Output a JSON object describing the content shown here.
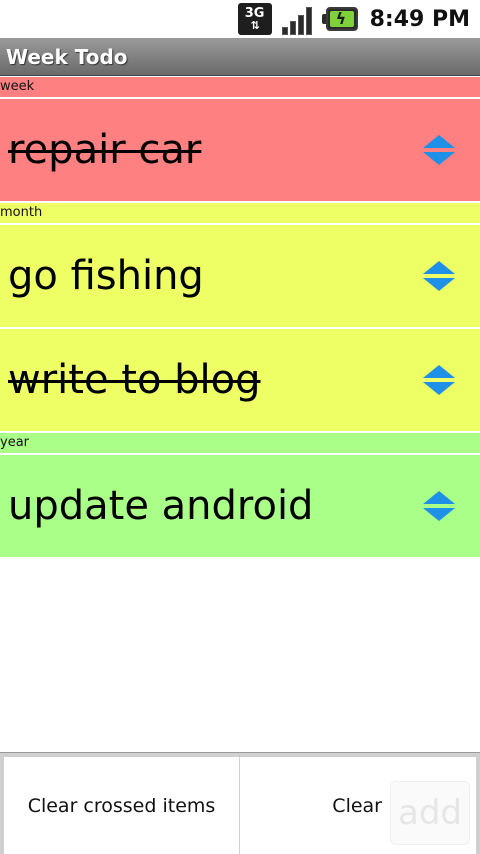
{
  "status_bar": {
    "network_label": "3G",
    "time": "8:49 PM",
    "icons": [
      "3g-data-icon",
      "signal-icon",
      "battery-charging-icon"
    ]
  },
  "app": {
    "title": "Week Todo"
  },
  "sections": [
    {
      "label": "week",
      "color": "#ff8080",
      "items": [
        {
          "text": "repair car",
          "crossed": true
        }
      ]
    },
    {
      "label": "month",
      "color": "#eeff66",
      "items": [
        {
          "text": "go fishing",
          "crossed": false
        },
        {
          "text": "write to blog",
          "crossed": true
        }
      ]
    },
    {
      "label": "year",
      "color": "#aaff88",
      "items": [
        {
          "text": "update android",
          "crossed": false
        }
      ]
    }
  ],
  "bottom_bar": {
    "clear_crossed_label": "Clear crossed items",
    "clear_label": "Clear",
    "add_label": "add"
  },
  "colors": {
    "sort_icon": "#1e90e8",
    "title_bar": "#7a7a7a"
  }
}
